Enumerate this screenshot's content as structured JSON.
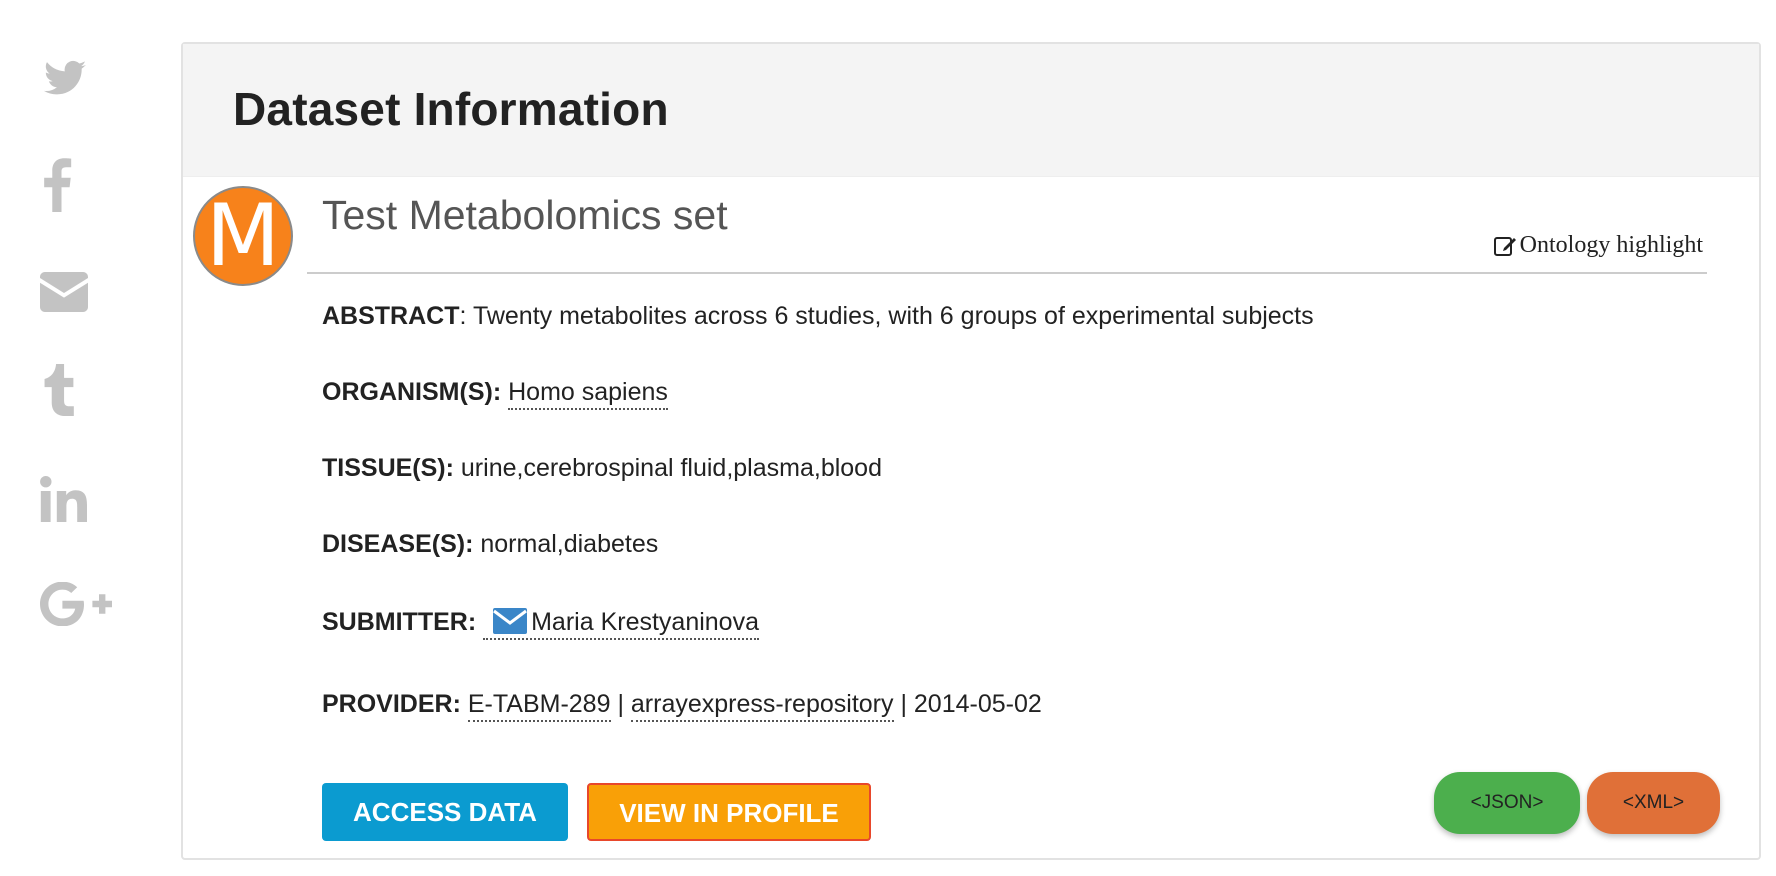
{
  "social": {
    "icons": [
      "twitter-icon",
      "facebook-icon",
      "email-icon",
      "tumblr-icon",
      "linkedin-icon",
      "google-plus-icon"
    ],
    "color": "#c3c3c3"
  },
  "card": {
    "header_title": "Dataset Information",
    "avatar_letter": "M",
    "avatar_color": "#f7821b",
    "dataset_title": "Test Metabolomics set",
    "ontology_label": "Ontology highlight",
    "fields": {
      "abstract_label": "ABSTRACT",
      "abstract_value": ": Twenty metabolites across 6 studies, with 6 groups of experimental subjects",
      "organism_label": "ORGANISM(S):",
      "organism_value": "Homo sapiens",
      "tissue_label": "TISSUE(S):",
      "tissue_value": "urine,cerebrospinal fluid,plasma,blood",
      "disease_label": "DISEASE(S):",
      "disease_value": "normal,diabetes",
      "submitter_label": "SUBMITTER:",
      "submitter_value": "Maria Krestyaninova",
      "provider_label": "PROVIDER:",
      "provider_accession": "E-TABM-289",
      "provider_separator": "|",
      "provider_repository": "arrayexpress-repository",
      "provider_date": "| 2014-05-02"
    },
    "buttons": {
      "access": "ACCESS DATA",
      "profile": "VIEW IN PROFILE",
      "json": "<JSON>",
      "xml": "<XML>"
    }
  }
}
